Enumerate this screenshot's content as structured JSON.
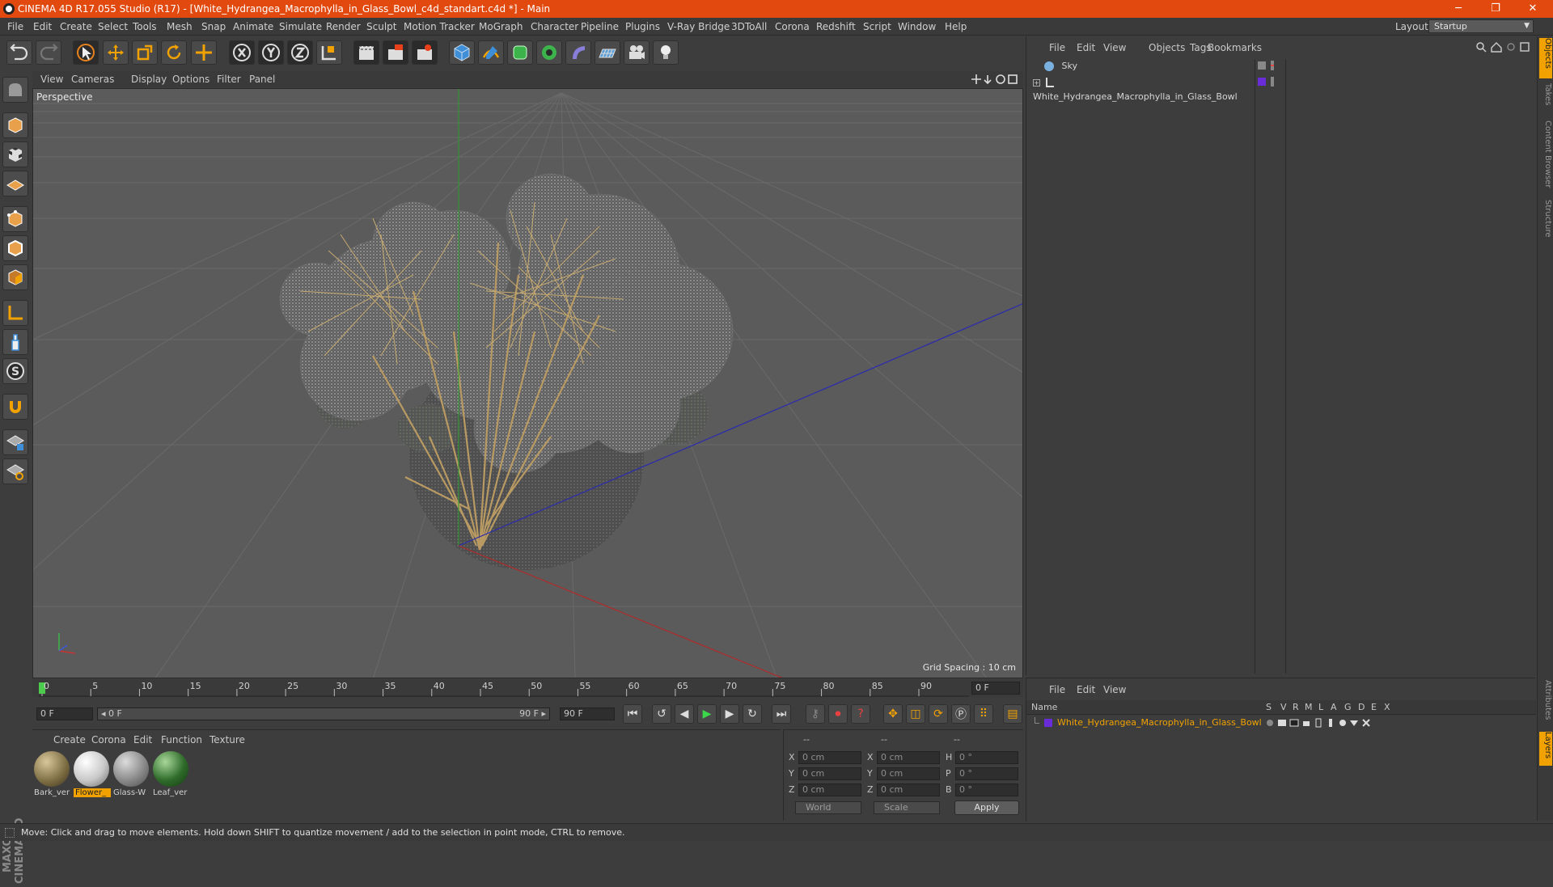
{
  "window": {
    "title": "CINEMA 4D R17.055 Studio (R17) - [White_Hydrangea_Macrophylla_in_Glass_Bowl_c4d_standart.c4d *] - Main",
    "minimize": "─",
    "restore": "❐",
    "close": "✕"
  },
  "menubar": {
    "items": [
      "File",
      "Edit",
      "Create",
      "Select",
      "Tools",
      "Mesh",
      "Snap",
      "Animate",
      "Simulate",
      "Render",
      "Sculpt",
      "Motion Tracker",
      "MoGraph",
      "Character",
      "Pipeline",
      "Plugins",
      "V-Ray Bridge",
      "3DToAll",
      "Corona",
      "Redshift",
      "Script",
      "Window",
      "Help"
    ],
    "layout_label": "Layout:",
    "layout_value": "Startup"
  },
  "viewport": {
    "menu": [
      "View",
      "Cameras",
      "Display",
      "Options",
      "Filter",
      "Panel"
    ],
    "label": "Perspective",
    "grid_spacing": "Grid Spacing : 10 cm"
  },
  "timeline": {
    "ticks": [
      "0",
      "5",
      "10",
      "15",
      "20",
      "25",
      "30",
      "35",
      "40",
      "45",
      "50",
      "55",
      "60",
      "65",
      "70",
      "75",
      "80",
      "85",
      "90"
    ],
    "current_frame": "0 F"
  },
  "transport": {
    "start_field": "0 F",
    "range_start": "◂ 0 F",
    "range_end": "90 F ▸",
    "end_field": "90 F"
  },
  "materials": {
    "menu": [
      "Create",
      "Corona",
      "Edit",
      "Function",
      "Texture"
    ],
    "items": [
      {
        "label": "Bark_ver",
        "color": "#7a6a40"
      },
      {
        "label": "Flower_",
        "color": "#d8d8d8"
      },
      {
        "label": "Glass-W",
        "color": "#9a9a9a"
      },
      {
        "label": "Leaf_ver",
        "color": "#2f6b2a"
      }
    ]
  },
  "coords": {
    "headers": [
      "--",
      "--",
      "--"
    ],
    "rows": [
      {
        "a": "X",
        "av": "0 cm",
        "b": "X",
        "bv": "0 cm",
        "c": "H",
        "cv": "0 °"
      },
      {
        "a": "Y",
        "av": "0 cm",
        "b": "Y",
        "bv": "0 cm",
        "c": "P",
        "cv": "0 °"
      },
      {
        "a": "Z",
        "av": "0 cm",
        "b": "Z",
        "bv": "0 cm",
        "c": "B",
        "cv": "0 °"
      }
    ],
    "space": "World",
    "mode": "Scale",
    "apply": "Apply"
  },
  "objects_panel": {
    "menu": [
      "File",
      "Edit",
      "View",
      "Objects",
      "Tags",
      "Bookmarks"
    ],
    "objects": [
      "Sky",
      "White_Hydrangea_Macrophylla_in_Glass_Bowl"
    ]
  },
  "layers_panel": {
    "menu": [
      "File",
      "Edit",
      "View"
    ],
    "columns": [
      "Name",
      "S",
      "V",
      "R",
      "M",
      "L",
      "A",
      "G",
      "D",
      "E",
      "X"
    ],
    "row": "White_Hydrangea_Macrophylla_in_Glass_Bowl",
    "row_color": "#f2a200"
  },
  "side_tabs": [
    "Objects",
    "Takes",
    "Content Browser",
    "Structure",
    "Attributes",
    "Layers"
  ],
  "branding": "MAXON CINEMA 4D",
  "status": "Move: Click and drag to move elements. Hold down SHIFT to quantize movement / add to the selection in point mode, CTRL to remove."
}
